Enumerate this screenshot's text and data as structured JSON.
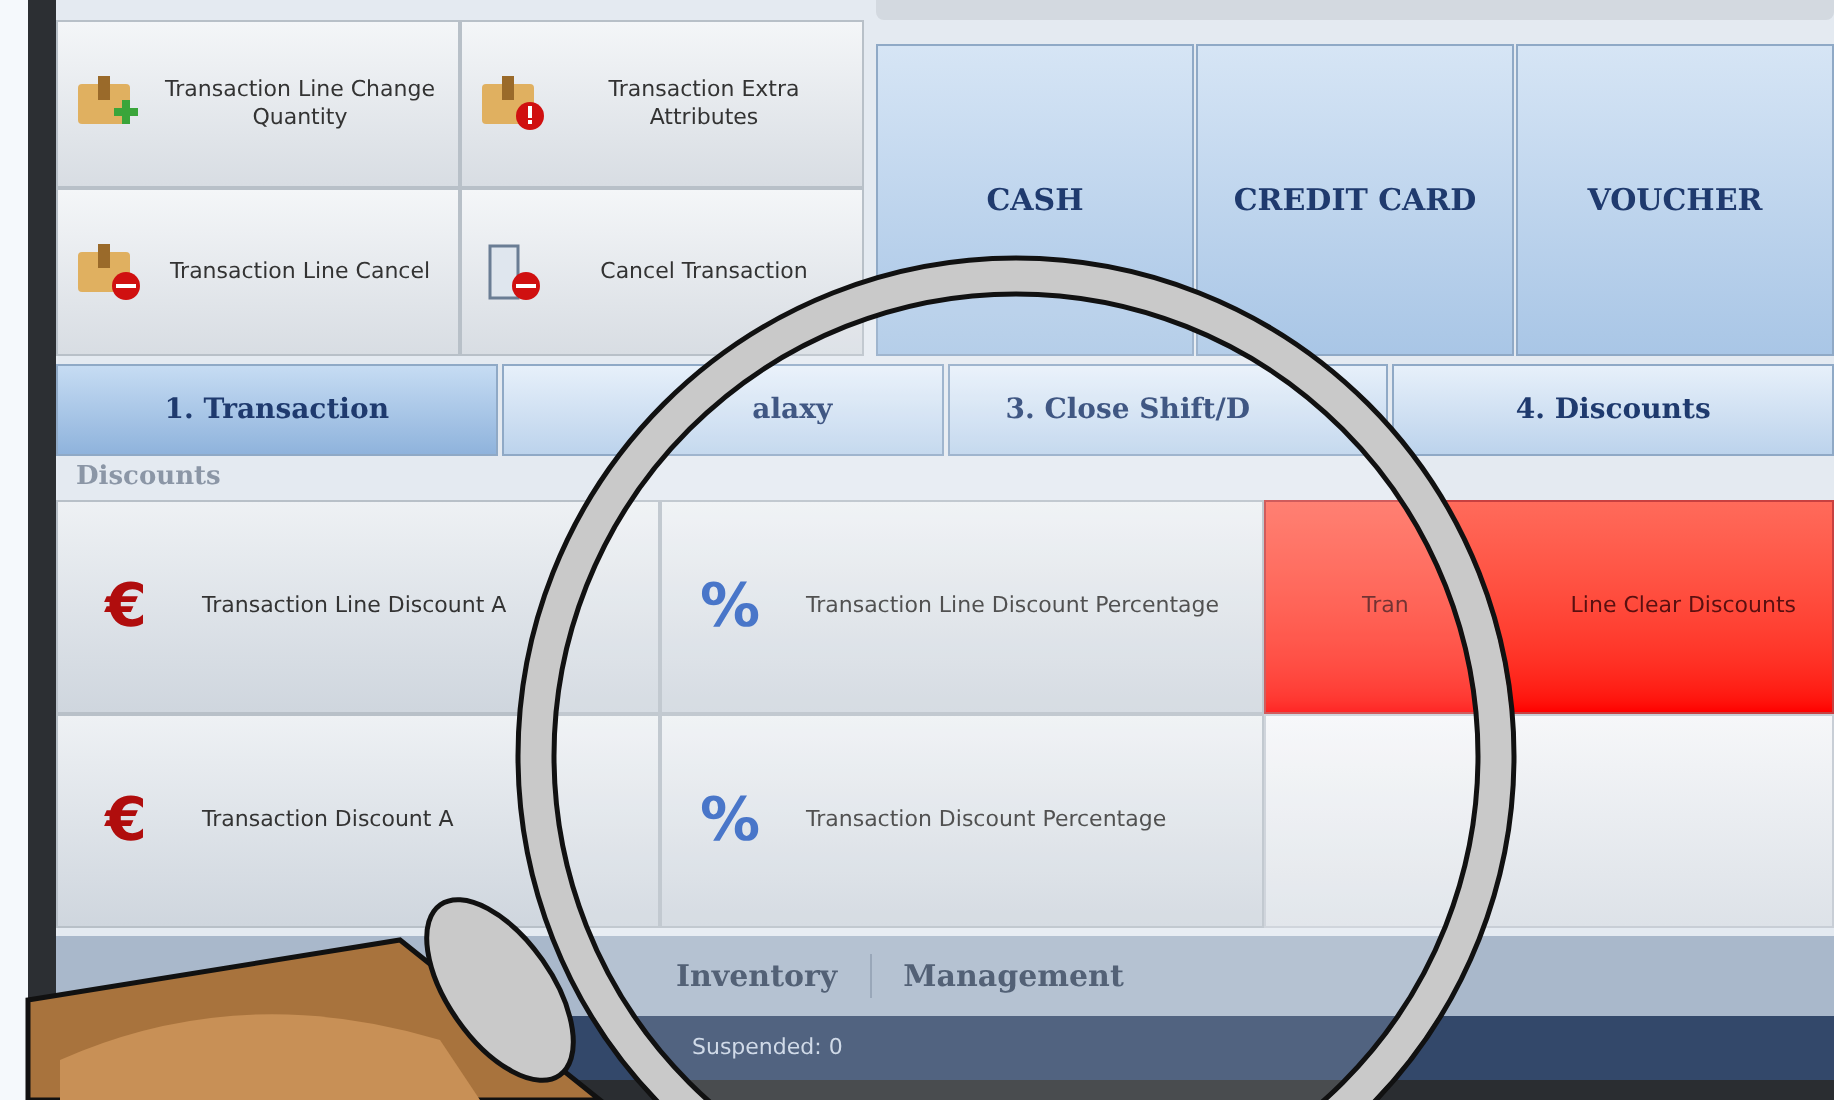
{
  "actions": [
    {
      "label": "Transaction Line Change Quantity",
      "kind": "add"
    },
    {
      "label": "Transaction Extra Attributes",
      "kind": "alert"
    },
    {
      "label": "Transaction Line Cancel",
      "kind": "cancel"
    },
    {
      "label": "Cancel Transaction",
      "kind": "document"
    }
  ],
  "payments": [
    "CASH",
    "CREDIT CARD",
    "VOUCHER"
  ],
  "tabs": [
    {
      "label": "1. Transaction",
      "selected": true
    },
    {
      "label": "alaxy",
      "selected": false
    },
    {
      "label": "3. Close Shift/D",
      "selected": false
    },
    {
      "label": "4. Discounts",
      "selected": false
    }
  ],
  "discounts": {
    "title": "Discounts",
    "buttons": [
      {
        "kind": "amount",
        "glyph": "€",
        "label": "Transaction Line Discount A"
      },
      {
        "kind": "percent",
        "glyph": "%",
        "label": "Transaction Line Discount Percentage"
      },
      {
        "kind": "clear",
        "texts": [
          "Tran",
          "Line Clear Discounts"
        ]
      },
      {
        "kind": "amount",
        "glyph": "€",
        "label": "Transaction Discount A"
      },
      {
        "kind": "percent",
        "glyph": "%",
        "label": "Transaction Discount Percentage"
      },
      {
        "kind": "empty"
      }
    ]
  },
  "bottom_tabs": [
    "Inventory",
    "Management"
  ],
  "status": "Suspended: 0"
}
